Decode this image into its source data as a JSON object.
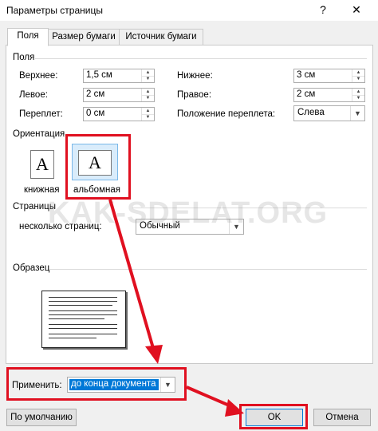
{
  "window": {
    "title": "Параметры страницы",
    "help_glyph": "?",
    "close_glyph": "✕"
  },
  "tabs": [
    {
      "label": "Поля"
    },
    {
      "label": "Размер бумаги"
    },
    {
      "label": "Источник бумаги"
    }
  ],
  "margins": {
    "group_label": "Поля",
    "top": {
      "label": "Верхнее:",
      "value": "1,5 см"
    },
    "bottom": {
      "label": "Нижнее:",
      "value": "3 см"
    },
    "left": {
      "label": "Левое:",
      "value": "2 см"
    },
    "right": {
      "label": "Правое:",
      "value": "2 см"
    },
    "gutter": {
      "label": "Переплет:",
      "value": "0 см"
    },
    "gutter_position": {
      "label": "Положение переплета:",
      "value": "Слева"
    }
  },
  "orientation": {
    "group_label": "Ориентация",
    "portrait": {
      "label": "книжная",
      "glyph": "A"
    },
    "landscape": {
      "label": "альбомная",
      "glyph": "A",
      "selected": true
    }
  },
  "pages": {
    "group_label": "Страницы",
    "multiple_label": "несколько страниц:",
    "multiple_value": "Обычный"
  },
  "sample": {
    "group_label": "Образец"
  },
  "apply": {
    "label": "Применить:",
    "value": "до конца документа"
  },
  "buttons": {
    "default_label": "По умолчанию",
    "ok_label": "OK",
    "cancel_label": "Отмена"
  },
  "watermark": "KAK-SDELAT.ORG",
  "colors": {
    "highlight": "#e01020",
    "selection": "#0078d7",
    "panel": "#ffffff"
  }
}
